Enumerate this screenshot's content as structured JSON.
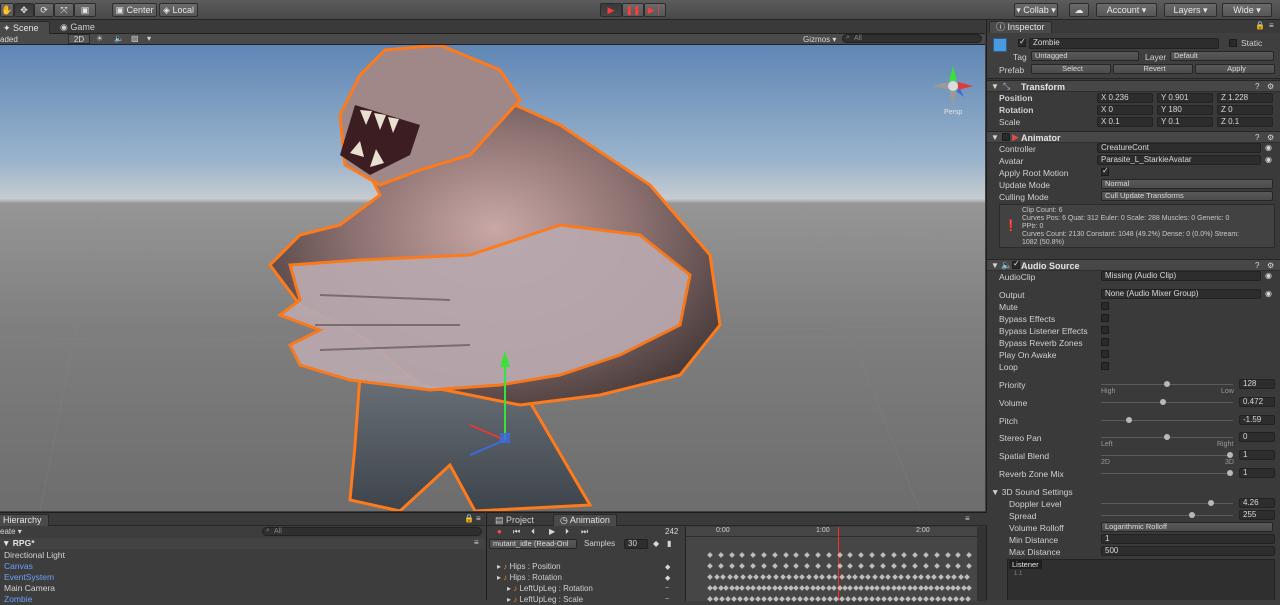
{
  "toolbar": {
    "pivot": "Center",
    "space": "Local",
    "collab": "▾ Collab ▾",
    "account": "Account",
    "layers": "Layers",
    "layout": "Wide"
  },
  "scene_tabs": {
    "scene": "Scene",
    "game": "Game"
  },
  "scene_bar": {
    "shading": "aded",
    "mode_2d": "2D",
    "gizmos": "Gizmos ▾",
    "search": "All"
  },
  "scene_view": {
    "persp_label": "Persp",
    "accent_color": "#ff7a1a"
  },
  "inspector": {
    "tab": "Inspector",
    "object_name": "Zombie",
    "static_label": "Static",
    "tag_label": "Tag",
    "tag_value": "Untagged",
    "layer_label": "Layer",
    "layer_value": "Default",
    "prefab_label": "Prefab",
    "prefab_select": "Select",
    "prefab_revert": "Revert",
    "prefab_apply": "Apply",
    "transform": {
      "title": "Transform",
      "position_label": "Position",
      "rotation_label": "Rotation",
      "scale_label": "Scale",
      "pos": {
        "x": "X 0.236",
        "y": "Y 0.901",
        "z": "Z 1.228"
      },
      "rot": {
        "x": "X 0",
        "y": "Y 180",
        "z": "Z 0"
      },
      "scl": {
        "x": "X 0.1",
        "y": "Y 0.1",
        "z": "Z 0.1"
      }
    },
    "animator": {
      "title": "Animator",
      "controller_label": "Controller",
      "controller_value": "CreatureCont",
      "avatar_label": "Avatar",
      "avatar_value": "Parasite_L_StarkieAvatar",
      "root_motion_label": "Apply Root Motion",
      "update_mode_label": "Update Mode",
      "update_mode_value": "Normal",
      "culling_label": "Culling Mode",
      "culling_value": "Cull Update Transforms",
      "info_1": "Clip Count: 6",
      "info_2": "Curves Pos: 6 Quat: 312 Euler: 0 Scale: 288 Muscles: 0 Generic: 0",
      "info_3": "PPtr: 0",
      "info_4": "Curves Count: 2130 Constant: 1048 (49.2%) Dense: 0 (0.0%) Stream:",
      "info_5": "1082 (50.8%)"
    },
    "audio": {
      "title": "Audio Source",
      "clip_label": "AudioClip",
      "clip_value": "Missing (Audio Clip)",
      "output_label": "Output",
      "output_value": "None (Audio Mixer Group)",
      "mute": "Mute",
      "bypass_effects": "Bypass Effects",
      "bypass_listener": "Bypass Listener Effects",
      "bypass_reverb": "Bypass Reverb Zones",
      "play_on_awake": "Play On Awake",
      "loop": "Loop",
      "priority_label": "Priority",
      "priority_value": "128",
      "priority_pos": 0.5,
      "high": "High",
      "low": "Low",
      "volume_label": "Volume",
      "volume_value": "0.472",
      "volume_pos": 0.472,
      "pitch_label": "Pitch",
      "pitch_value": "-1.59",
      "pitch_pos": 0.2,
      "stereo_label": "Stereo Pan",
      "stereo_value": "0",
      "stereo_pos": 0.5,
      "left": "Left",
      "right": "Right",
      "spatial_label": "Spatial Blend",
      "spatial_value": "1",
      "spatial_pos": 1.0,
      "sub_2d": "2D",
      "sub_3d": "3D",
      "reverb_label": "Reverb Zone Mix",
      "reverb_value": "1",
      "reverb_pos": 1.0,
      "sound3d_label": "3D Sound Settings",
      "doppler_label": "Doppler Level",
      "doppler_value": "4.26",
      "doppler_pos": 0.85,
      "spread_label": "Spread",
      "spread_value": "255",
      "spread_pos": 0.7,
      "rolloff_label": "Volume Rolloff",
      "rolloff_value": "Logarithmic Rolloff",
      "min_label": "Min Distance",
      "min_value": "1",
      "max_label": "Max Distance",
      "max_value": "500",
      "listener": "Listener",
      "graph_tick": "1.1"
    }
  },
  "hierarchy": {
    "tab": "Hierarchy",
    "create": "eate ▾",
    "search": "All",
    "scene_name": "RPG*",
    "items": [
      "Directional Light",
      "Canvas",
      "EventSystem",
      "Main Camera",
      "Zombie"
    ]
  },
  "animation": {
    "project_tab": "Project",
    "tab": "Animation",
    "frame": "242",
    "clip": "mutant_idle (Read-Onl",
    "samples_label": "Samples",
    "samples_value": "30",
    "time_0": "0:00",
    "time_1": "1:00",
    "time_2": "2:00",
    "props": [
      "Hips : Position",
      "Hips : Rotation",
      "LeftUpLeg : Rotation",
      "LeftUpLeg : Scale"
    ]
  }
}
